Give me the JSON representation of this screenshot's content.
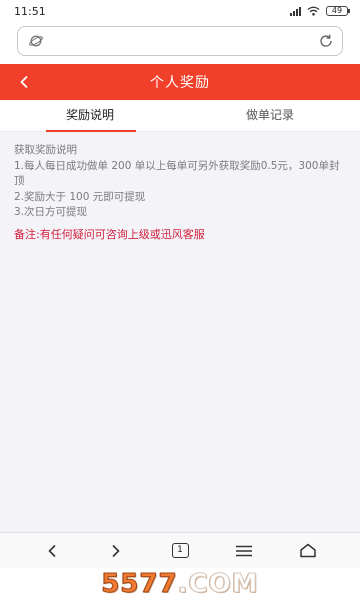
{
  "status_bar": {
    "time": "11:51",
    "battery": "49"
  },
  "browser": {
    "url": ""
  },
  "header": {
    "back_icon": "chevron-left-icon",
    "title": "个人奖励"
  },
  "tabs": [
    {
      "label": "奖励说明",
      "active": true
    },
    {
      "label": "做单记录",
      "active": false
    }
  ],
  "content": {
    "heading": "获取奖励说明",
    "rules": [
      "1.每人每日成功做单 200 单以上每单可另外获取奖励0.5元，300单封顶",
      "2.奖励大于 100 元即可提现",
      "3.次日方可提现"
    ],
    "note": "备注:有任何疑问可咨询上级或迅风客服"
  },
  "bottom_nav": {
    "tab_count": "1",
    "items": [
      "back-icon",
      "forward-icon",
      "tabs-icon",
      "menu-icon",
      "home-icon"
    ]
  },
  "watermark": {
    "number": "5577",
    "suffix": ".COM"
  },
  "colors": {
    "accent": "#f0402a",
    "note": "#d11f3c",
    "background": "#f4f3f8"
  }
}
